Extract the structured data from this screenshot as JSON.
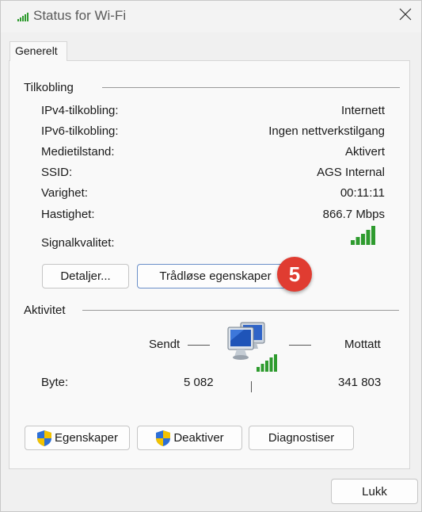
{
  "window": {
    "title": "Status for Wi-Fi"
  },
  "tabs": [
    {
      "label": "Generelt",
      "active": true
    }
  ],
  "connection": {
    "group_label": "Tilkobling",
    "rows": [
      {
        "label": "IPv4-tilkobling:",
        "value": "Internett"
      },
      {
        "label": "IPv6-tilkobling:",
        "value": "Ingen nettverkstilgang"
      },
      {
        "label": "Medietilstand:",
        "value": "Aktivert"
      },
      {
        "label": "SSID:",
        "value": "AGS Internal"
      },
      {
        "label": "Varighet:",
        "value": "00:11:11"
      },
      {
        "label": "Hastighet:",
        "value": "866.7 Mbps"
      }
    ],
    "signal_label": "Signalkvalitet:",
    "signal_bars": 5,
    "details_button": "Detaljer...",
    "wireless_button": "Trådløse egenskaper",
    "step_badge": "5"
  },
  "activity": {
    "group_label": "Aktivitet",
    "sent_label": "Sendt",
    "received_label": "Mottatt",
    "bytes_label": "Byte:",
    "bytes_sent": "5 082",
    "bytes_received": "341 803"
  },
  "action_buttons": {
    "properties": "Egenskaper",
    "disable": "Deaktiver",
    "diagnose": "Diagnostiser"
  },
  "footer": {
    "close_button": "Lukk"
  },
  "colors": {
    "signal_green": "#2e9b2e",
    "badge_red": "#e03c31",
    "shield_blue": "#2d6fd6",
    "shield_yellow": "#f2c200"
  },
  "icons": [
    "wifi-signal-icon",
    "close-icon",
    "network-computers-icon",
    "uac-shield-icon"
  ]
}
